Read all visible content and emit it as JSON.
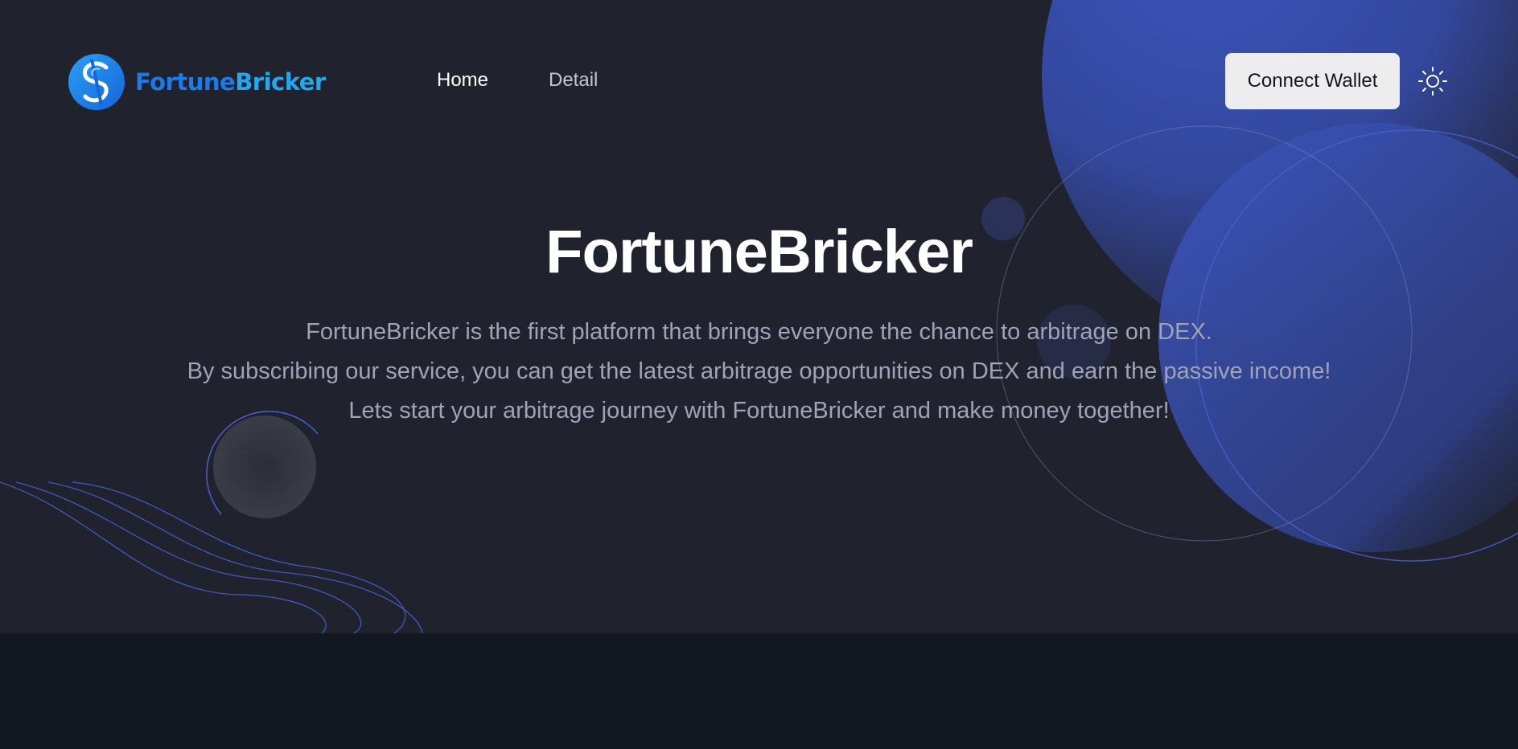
{
  "brand": {
    "name_part1": "Fortune",
    "name_part2": "Bricker",
    "logo_icon": "dollar-swirl-logo"
  },
  "nav": {
    "items": [
      {
        "label": "Home",
        "active": true
      },
      {
        "label": "Detail",
        "active": false
      }
    ]
  },
  "header": {
    "connect_wallet_label": "Connect Wallet",
    "theme_icon": "sun-icon"
  },
  "hero": {
    "title": "FortuneBricker",
    "lines": [
      "FortuneBricker is the first platform that brings everyone the chance to arbitrage on DEX.",
      "By subscribing our service, you can get the latest arbitrage opportunities on DEX and earn the passive income!",
      "Lets start your arbitrage journey with FortuneBricker and make money together!"
    ]
  },
  "colors": {
    "hero_background": "#20232e",
    "page_background": "#131722",
    "accent_blue": "#3a50b4",
    "brand_blue": "#1d7be8",
    "button_background": "#ededf0"
  }
}
